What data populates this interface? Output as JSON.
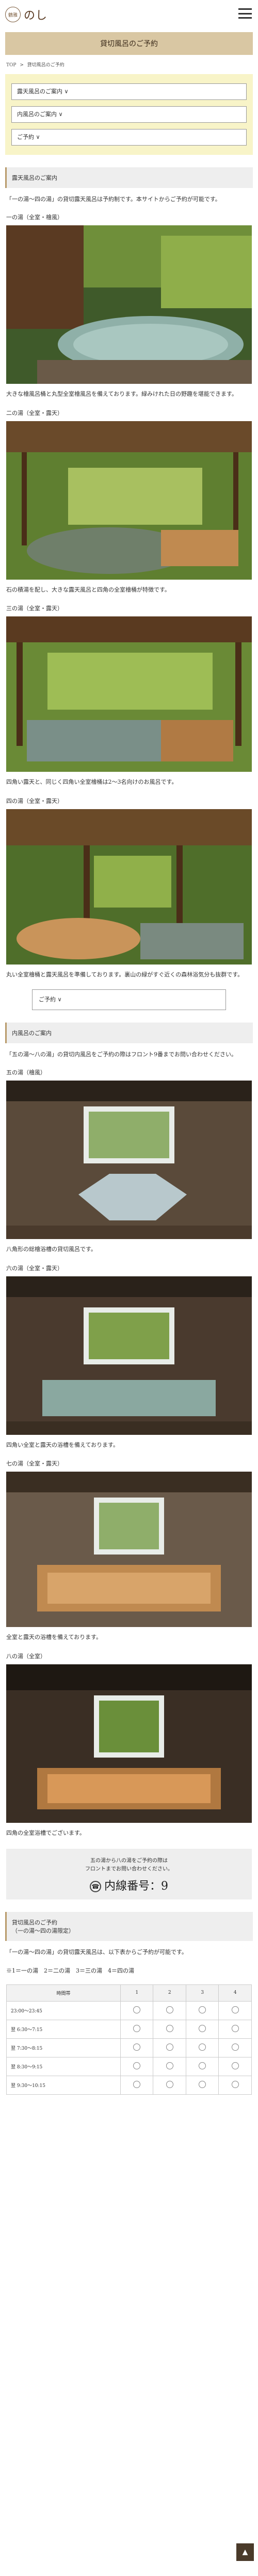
{
  "header": {
    "logo_mark": "鶴雅",
    "logo_text": "のし",
    "menu_icon": "hamburger-icon"
  },
  "page_title": "貸切風呂のご予約",
  "breadcrumb": [
    "TOP",
    ">",
    "貸切風呂のご予約"
  ],
  "menu": [
    "露天風呂のご案内 ∨",
    "内風呂のご案内 ∨",
    "ご予約 ∨"
  ],
  "outdoor": {
    "heading": "露天風呂のご案内",
    "intro": "「一の湯～四の湯」の貸切露天風呂は予約制です。本サイトからご予約が可能です。",
    "baths": [
      {
        "name": "一の湯（全室・檜風）",
        "caption": "大きな檜風呂桶と丸型全室檜風呂を備えております。緑みけれた日の野趣を堪能できます。"
      },
      {
        "name": "二の湯（全室・露天）",
        "caption": "石の積湯を配し、大きな露天風呂と四角の全室檜桶が特徴です。"
      },
      {
        "name": "三の湯（全室・露天）",
        "caption": "四角い露天と、同じく四角い全室檜桶は2～3名向けのお風呂です。"
      },
      {
        "name": "四の湯（全室・露天）",
        "caption": "丸い全室檜桶と露天風呂を準備しております。裏山の緑がすぐ近くの森林浴気分も抜群です。"
      }
    ],
    "reserve_label": "ご予約 ∨"
  },
  "indoor": {
    "heading": "内風呂のご案内",
    "intro": "「五の湯～八の湯」の貸切内風呂をご予約の際はフロント9番までお問い合わせください。",
    "baths": [
      {
        "name": "五の湯（檜風）",
        "caption": "八角形の総檜浴槽の貸切風呂です。"
      },
      {
        "name": "六の湯（全室・露天）",
        "caption": "四角い全室と露天の浴槽を備えております。"
      },
      {
        "name": "七の湯（全室・露天）",
        "caption": "全室と露天の浴槽を備えております。"
      },
      {
        "name": "八の湯（全室）",
        "caption": "四角の全室浴槽でございます。"
      }
    ],
    "info_lines": [
      "五の湯から八の湯をご予約の際は",
      "フロントまでお問い合わせください。"
    ],
    "phone": "内線番号：9"
  },
  "schedule": {
    "heading_lines": [
      "貸切風呂のご予約",
      "（一の湯～四の湯限定）"
    ],
    "note": "「一の湯～四の湯」の貸切露天風呂は、以下表からご予約が可能です。",
    "legend": "※1＝一の湯　2＝二の湯　3＝三の湯　4＝四の湯",
    "columns": [
      "時間帯",
      "1",
      "2",
      "3",
      "4"
    ],
    "rows": [
      "23:00～23:45",
      "翌 6:30～7:15",
      "翌 7:30～8:15",
      "翌 8:30～9:15",
      "翌 9:30～10:15"
    ]
  },
  "pagetop_label": "▲"
}
